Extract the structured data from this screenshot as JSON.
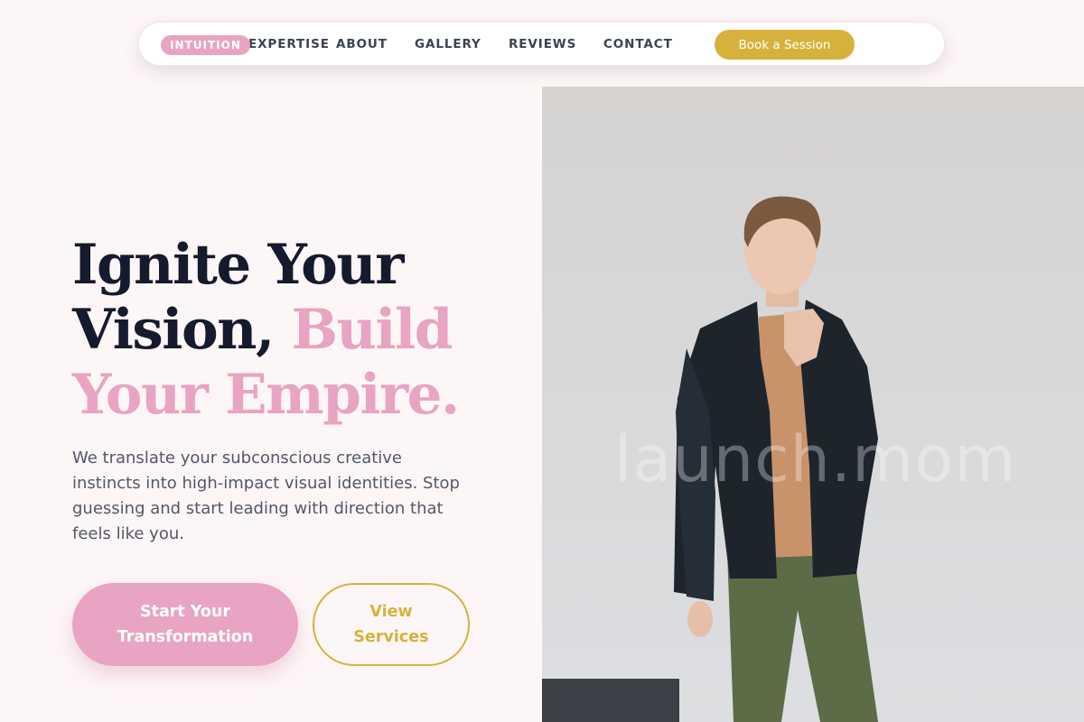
{
  "nav": {
    "highlight_label": "INTUITION",
    "links": [
      "EXPERTISE",
      "ABOUT",
      "GALLERY",
      "REVIEWS",
      "CONTACT"
    ],
    "cta_label": "Book a Session"
  },
  "hero": {
    "headline_line1": "Ignite Your",
    "headline_line2_dark": "Vision,",
    "headline_line2_pink": "Build",
    "headline_line3_pink": "Your Empire.",
    "subtext": "We translate your subconscious creative instincts into high-impact visual identities. Stop guessing and start leading with direction that feels like you.",
    "primary_cta": "Start Your Transformation",
    "secondary_cta": "View Services"
  },
  "photo": {
    "watermark": "launch.mom",
    "subject": "model-portrait"
  },
  "colors": {
    "background": "#fdf6f6",
    "accent_pink": "#e8a4c2",
    "accent_gold": "#d6b23c",
    "text_dark": "#151a2c"
  }
}
